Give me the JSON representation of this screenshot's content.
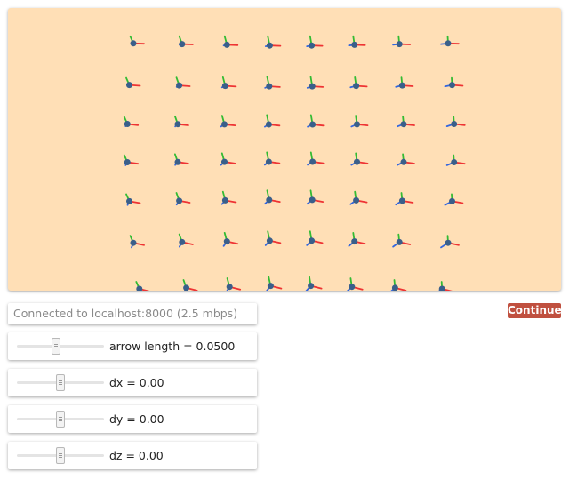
{
  "viewport": {
    "background": "#ffdfb6"
  },
  "status": {
    "text": "Connected to localhost:8000 (2.5 mbps)"
  },
  "continue_button": {
    "label": "Continue",
    "color": "#c0503f"
  },
  "sliders": [
    {
      "label": "arrow length = 0.0500",
      "level": 0.45
    },
    {
      "label": "dx = 0.00",
      "level": 0.5
    },
    {
      "label": "dy = 0.00",
      "level": 0.5
    },
    {
      "label": "dz = 0.00",
      "level": 0.5
    }
  ],
  "axis_colors": {
    "x": "#ee3333",
    "y": "#33bb33",
    "z": "#3366dd",
    "center": "#3a5f8a"
  }
}
